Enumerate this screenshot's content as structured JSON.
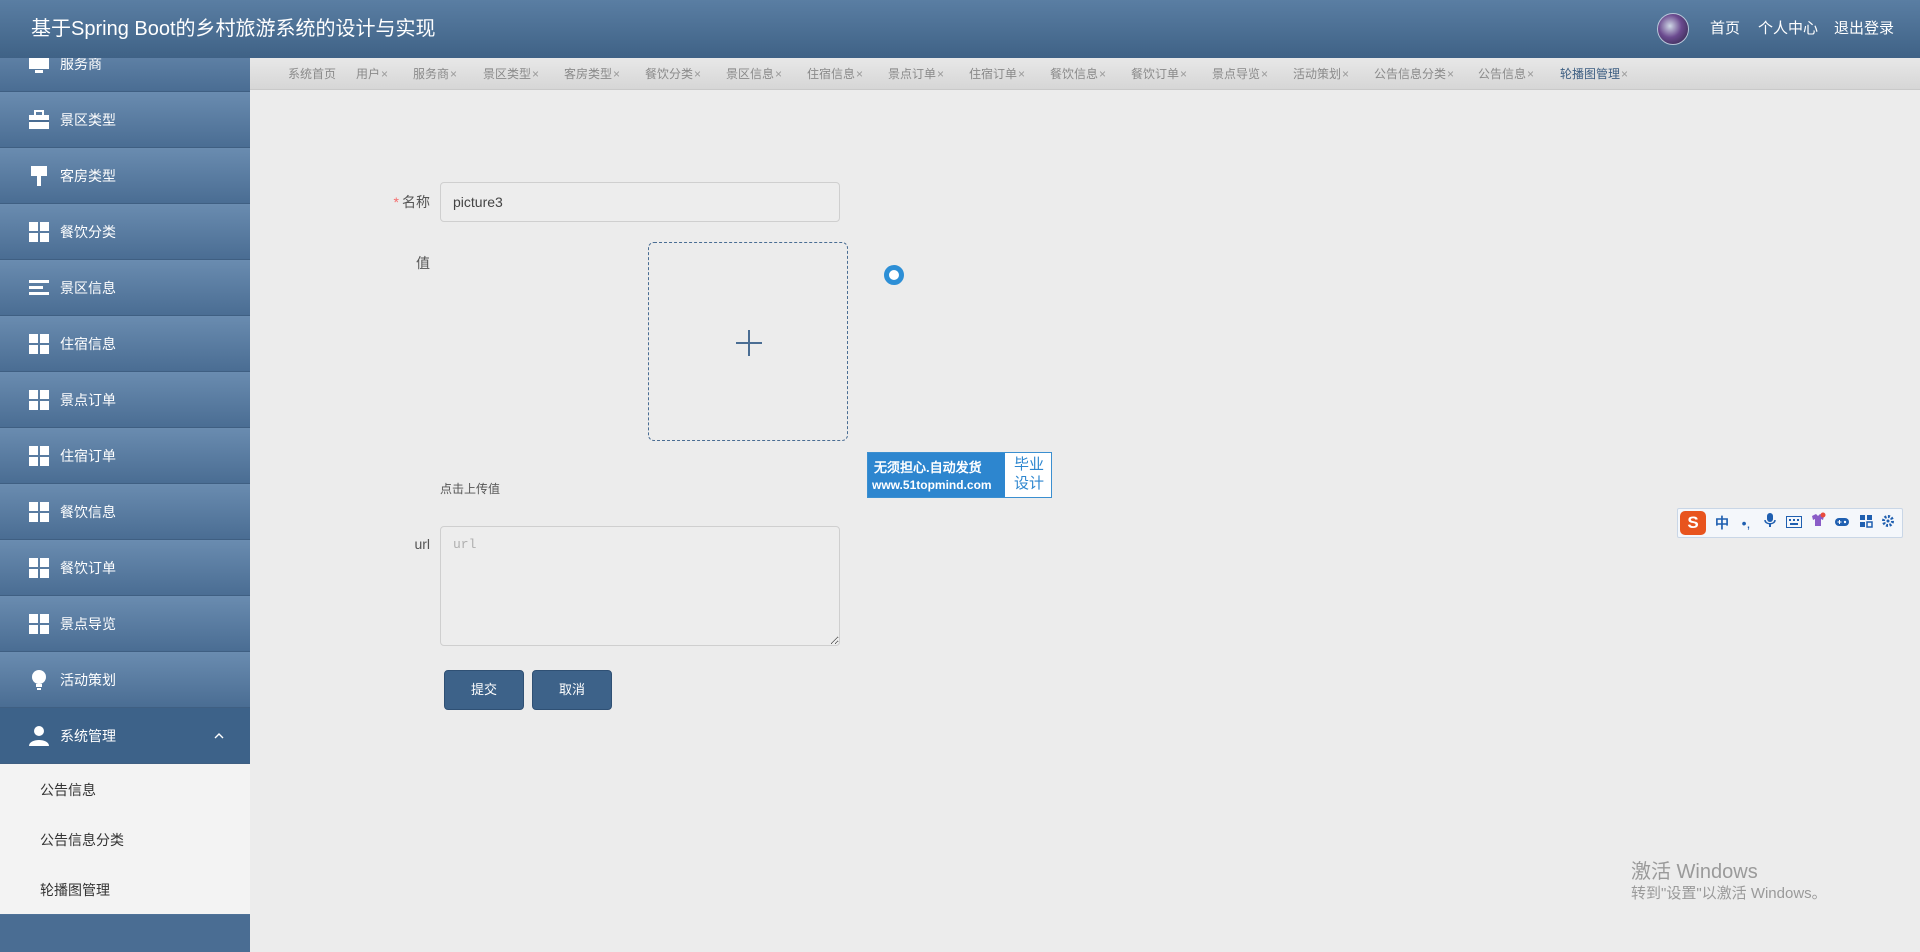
{
  "header": {
    "title": "基于Spring Boot的乡村旅游系统的设计与实现",
    "links": [
      "首页",
      "个人中心",
      "退出登录"
    ]
  },
  "sidebar": {
    "items": [
      {
        "label": "服务商",
        "icon": "monitor-icon"
      },
      {
        "label": "景区类型",
        "icon": "briefcase-icon"
      },
      {
        "label": "客房类型",
        "icon": "brush-icon"
      },
      {
        "label": "餐饮分类",
        "icon": "grid-icon"
      },
      {
        "label": "景区信息",
        "icon": "list-icon"
      },
      {
        "label": "住宿信息",
        "icon": "grid-icon"
      },
      {
        "label": "景点订单",
        "icon": "grid-icon"
      },
      {
        "label": "住宿订单",
        "icon": "grid-icon"
      },
      {
        "label": "餐饮信息",
        "icon": "grid-icon"
      },
      {
        "label": "餐饮订单",
        "icon": "grid-icon"
      },
      {
        "label": "景点导览",
        "icon": "grid-icon"
      },
      {
        "label": "活动策划",
        "icon": "bulb-icon"
      },
      {
        "label": "系统管理",
        "icon": "user-icon"
      }
    ],
    "submenu": [
      "公告信息",
      "公告信息分类",
      "轮播图管理"
    ]
  },
  "tabs": [
    {
      "label": "系统首页",
      "closable": false
    },
    {
      "label": "用户",
      "closable": true
    },
    {
      "label": "服务商",
      "closable": true
    },
    {
      "label": "景区类型",
      "closable": true
    },
    {
      "label": "客房类型",
      "closable": true
    },
    {
      "label": "餐饮分类",
      "closable": true
    },
    {
      "label": "景区信息",
      "closable": true
    },
    {
      "label": "住宿信息",
      "closable": true
    },
    {
      "label": "景点订单",
      "closable": true
    },
    {
      "label": "住宿订单",
      "closable": true
    },
    {
      "label": "餐饮信息",
      "closable": true
    },
    {
      "label": "餐饮订单",
      "closable": true
    },
    {
      "label": "景点导览",
      "closable": true
    },
    {
      "label": "活动策划",
      "closable": true
    },
    {
      "label": "公告信息分类",
      "closable": true
    },
    {
      "label": "公告信息",
      "closable": true
    },
    {
      "label": "轮播图管理",
      "closable": true
    }
  ],
  "tab_close_glyph": "×",
  "form": {
    "name_label": "名称",
    "name_value": "picture3",
    "value_label": "值",
    "upload_hint": "点击上传值",
    "url_label": "url",
    "url_placeholder": "url",
    "submit_label": "提交",
    "cancel_label": "取消"
  },
  "ad": {
    "line1": "无须担心.自动发货",
    "line2": "www.51topmind.com",
    "side": "毕业设计"
  },
  "ime": {
    "logo": "S",
    "mode": "中"
  },
  "watermark": {
    "line1": "激活 Windows",
    "line2": "转到\"设置\"以激活 Windows。"
  },
  "colors": {
    "primary": "#3d6289",
    "required": "#f56c6c",
    "spinner": "#2d8fd6"
  }
}
